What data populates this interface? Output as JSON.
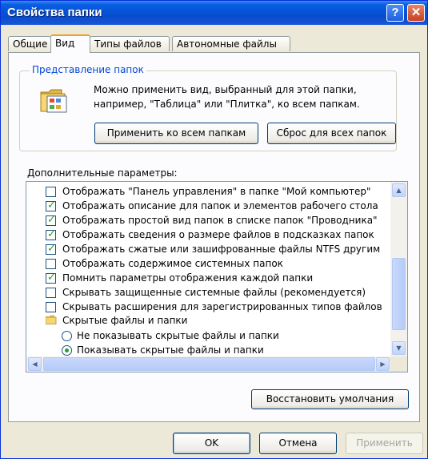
{
  "window": {
    "title": "Свойства папки"
  },
  "tabs": [
    {
      "label": "Общие",
      "active": false
    },
    {
      "label": "Вид",
      "active": true
    },
    {
      "label": "Типы файлов",
      "active": false
    },
    {
      "label": "Автономные файлы",
      "active": false
    }
  ],
  "folder_views": {
    "group_label": "Представление папок",
    "description": "Можно применить вид, выбранный для этой папки, например, \"Таблица\" или \"Плитка\", ко всем папкам.",
    "apply_all_label": "Применить ко всем папкам",
    "reset_all_label": "Сброс для всех папок"
  },
  "advanced": {
    "label": "Дополнительные параметры:",
    "items": [
      {
        "type": "checkbox",
        "checked": false,
        "label": "Отображать \"Панель управления\" в папке \"Мой компьютер\""
      },
      {
        "type": "checkbox",
        "checked": true,
        "label": "Отображать описание для папок и элементов рабочего стола"
      },
      {
        "type": "checkbox",
        "checked": true,
        "label": "Отображать простой вид папок в списке папок \"Проводника\""
      },
      {
        "type": "checkbox",
        "checked": true,
        "label": "Отображать сведения о размере файлов в подсказках папок"
      },
      {
        "type": "checkbox",
        "checked": true,
        "label": "Отображать сжатые или зашифрованные файлы NTFS другим"
      },
      {
        "type": "checkbox",
        "checked": false,
        "label": "Отображать содержимое системных папок"
      },
      {
        "type": "checkbox",
        "checked": true,
        "label": "Помнить параметры отображения каждой папки"
      },
      {
        "type": "checkbox",
        "checked": false,
        "label": "Скрывать защищенные системные файлы (рекомендуется)"
      },
      {
        "type": "checkbox",
        "checked": false,
        "label": "Скрывать расширения для зарегистрированных типов файлов"
      },
      {
        "type": "folder",
        "label": "Скрытые файлы и папки"
      },
      {
        "type": "radio",
        "checked": false,
        "label": "Не показывать скрытые файлы и папки"
      },
      {
        "type": "radio",
        "checked": true,
        "label": "Показывать скрытые файлы и папки"
      }
    ],
    "restore_label": "Восстановить умолчания"
  },
  "footer": {
    "ok_label": "OK",
    "cancel_label": "Отмена",
    "apply_label": "Применить"
  },
  "colors": {
    "title_bar": "#0a5fe2",
    "check_mark": "#21a121",
    "group_label": "#0046d5"
  }
}
